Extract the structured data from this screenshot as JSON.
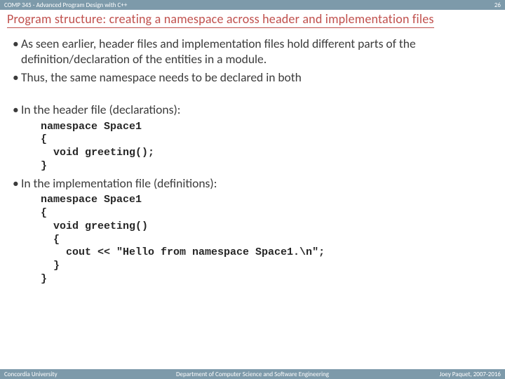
{
  "header": {
    "course": "COMP 345 - Advanced Program Design with C++",
    "page_number": "26"
  },
  "title": "Program structure: creating a namespace across header and implementation files",
  "bullets": {
    "b1": "As seen earlier, header files and implementation files hold different parts of the definition/declaration of the entities in a module.",
    "b2": "Thus, the same namespace needs to be declared in both",
    "b3": "In the header file (declarations):",
    "b4": "In the implementation file (definitions):"
  },
  "code": {
    "header_decl": "namespace Space1\n{\n  void greeting();\n}",
    "impl_def": "namespace Space1\n{\n  void greeting()\n  {\n    cout << \"Hello from namespace Space1.\\n\";\n  }\n}"
  },
  "footer": {
    "left": "Concordia University",
    "center": "Department of Computer Science and Software Engineering",
    "right": "Joey Paquet, 2007-2016"
  }
}
